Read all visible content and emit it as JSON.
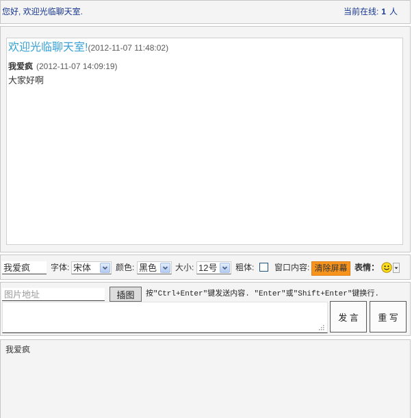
{
  "header": {
    "greeting": "您好, 欢迎光临聊天室.",
    "online_label": "当前在线:",
    "online_count": "1",
    "online_unit": "人"
  },
  "chat": {
    "welcome": {
      "text": "欢迎光临聊天室!",
      "time": "(2012-11-07 11:48:02)"
    },
    "messages": [
      {
        "user": "我爱疯",
        "time": "(2012-11-07 14:09:19)",
        "text": "大家好啊"
      }
    ]
  },
  "toolbar": {
    "nickname_value": "我爱疯",
    "font_label": "字体:",
    "font_value": "宋体",
    "color_label": "颜色:",
    "color_value": "黑色",
    "size_label": "大小:",
    "size_value": "12号",
    "bold_label": "粗体:",
    "bold_checked": false,
    "window_label": "窗口内容:",
    "clear_label": "清除屏幕",
    "emoji_label": "表情："
  },
  "compose": {
    "image_placeholder": "图片地址",
    "insert_label": "插图",
    "hint": "按\"Ctrl+Enter\"键发送内容. \"Enter\"或\"Shift+Enter\"键换行.",
    "send_label": "发 言",
    "reset_label": "重 写"
  },
  "users": [
    "我爱疯"
  ],
  "icons": {
    "select_arrow": "chevron-down-icon",
    "emoji": "smiley-icon",
    "emoji_dropdown": "caret-down-icon",
    "textarea_resize": "resize-grip-icon"
  },
  "colors": {
    "accent": "#35a0d6",
    "header_text": "#16368f",
    "clear_button": "#f7941d"
  }
}
